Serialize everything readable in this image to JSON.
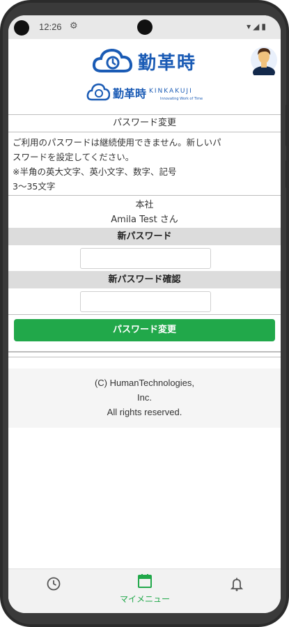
{
  "status_bar": {
    "time": "12:26",
    "icons": [
      "settings-icon",
      "wifi-icon",
      "signal-icon",
      "battery-icon"
    ]
  },
  "header": {
    "logo_text": "勤革時",
    "sub_logo_jp": "勤革時",
    "sub_logo_en": "KINKAKUJI",
    "sub_logo_tagline": "Innovating Work of Time",
    "brand_color": "#1a5bb5"
  },
  "page": {
    "title": "パスワード変更",
    "notice_lines": [
      "ご利用のパスワードは継続使用できません。新しいパ",
      "スワードを設定してください。",
      "※半角の英大文字、英小文字、数字、記号",
      "3〜35文字"
    ],
    "company": "本社",
    "user": "Amila Test さん"
  },
  "form": {
    "new_password_label": "新パスワード",
    "new_password_value": "",
    "confirm_password_label": "新パスワード確認",
    "confirm_password_value": "",
    "submit_label": "パスワード変更",
    "submit_color": "#21a84a"
  },
  "footer": {
    "lines": [
      "(C) HumanTechnologies,",
      "Inc.",
      "All rights reserved."
    ]
  },
  "bottom_nav": {
    "items": [
      {
        "icon": "clock-icon",
        "label": ""
      },
      {
        "icon": "calendar-icon",
        "label": "マイメニュー"
      },
      {
        "icon": "bell-icon",
        "label": ""
      }
    ],
    "active_color": "#21a84a"
  }
}
